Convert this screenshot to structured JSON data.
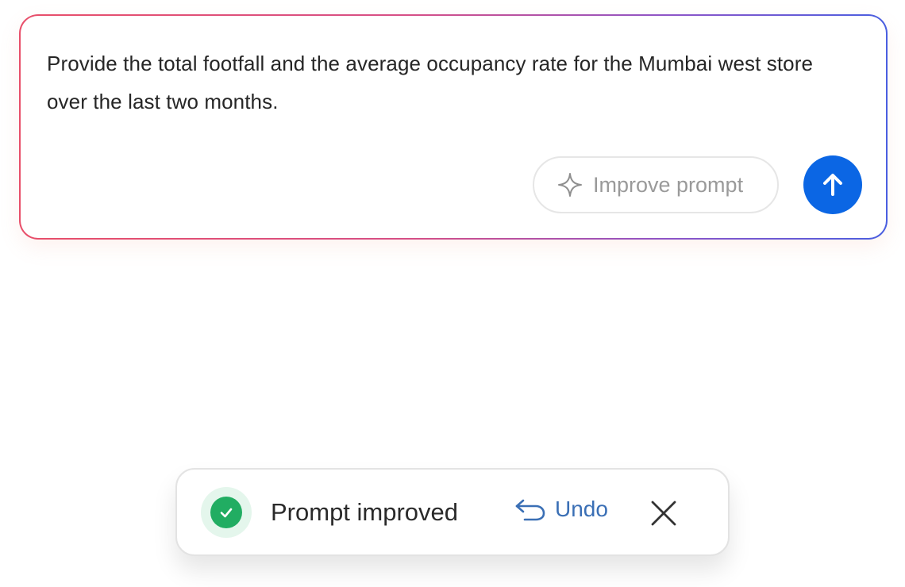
{
  "composer": {
    "prompt_text": "Provide the total footfall and the average occupancy rate for the Mumbai west store over the last two months.",
    "improve_label": "Improve prompt",
    "improve_icon": "sparkle-icon",
    "send_icon": "arrow-up-icon",
    "colors": {
      "send_button": "#0b66e4",
      "border_gradient_start": "#e84f6a",
      "border_gradient_end": "#4a5fe0"
    }
  },
  "toast": {
    "message": "Prompt improved",
    "status_icon": "check-circle-icon",
    "undo_label": "Undo",
    "undo_icon": "undo-arrow-icon",
    "close_icon": "close-icon",
    "colors": {
      "success": "#21ad62",
      "link": "#3a6fb5"
    }
  }
}
